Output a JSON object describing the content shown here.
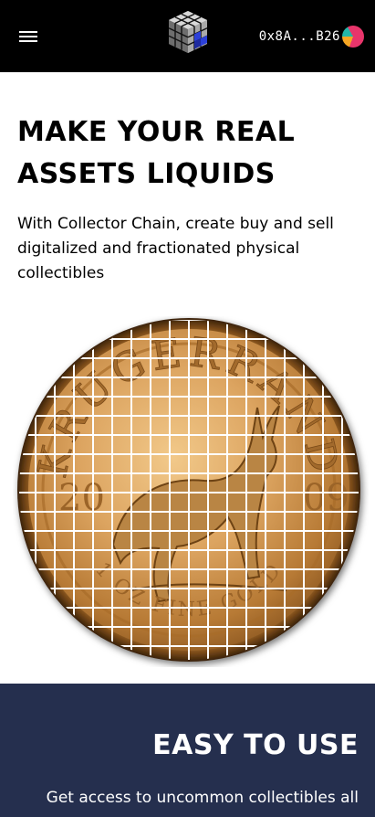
{
  "header": {
    "menu_icon": "hamburger-menu-icon",
    "logo_icon": "cube-logo-icon",
    "wallet_address": "0x8A...B26",
    "wallet_avatar_colors": [
      "#e8356b",
      "#f6a623",
      "#22b6a8"
    ]
  },
  "hero": {
    "title_line1": "MAKE YOUR REAL",
    "title_line2": "ASSETS LIQUIDS",
    "description": "With Collector Chain, create buy and sell digitalized and fractionated physical collectibles",
    "image": {
      "subject": "gold-coin-icon",
      "coin_lettering": "KRUGERRAND",
      "coin_year_left": "20",
      "coin_year_right": "09",
      "coin_bottom_lettering": "1 OZ FINE GOLD"
    }
  },
  "easy_section": {
    "title": "EASY TO USE",
    "description": "Get access to uncommon collectibles all"
  },
  "colors": {
    "header_bg": "#000000",
    "section_bg": "#252f4e",
    "coin_gold": "#d9a35e"
  }
}
